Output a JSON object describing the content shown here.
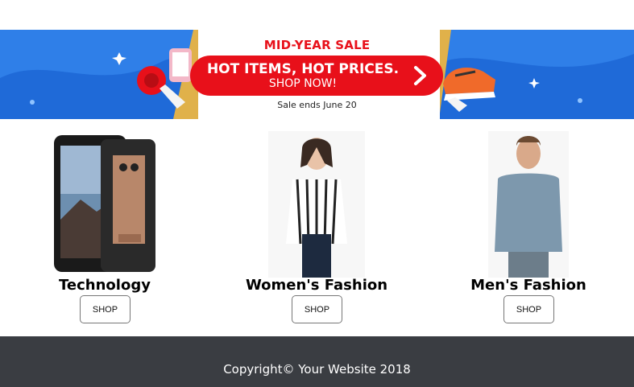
{
  "banner": {
    "title": "MID-YEAR SALE",
    "headline": "HOT ITEMS, HOT PRICES.",
    "cta": "SHOP NOW!",
    "sale_ends": "Sale ends June 20",
    "colors": {
      "accent": "#e8101a",
      "background": "#2f7fe8"
    }
  },
  "products": [
    {
      "title": "Technology",
      "button": "SHOP"
    },
    {
      "title": "Women's Fashion",
      "button": "SHOP"
    },
    {
      "title": "Men's Fashion",
      "button": "SHOP"
    }
  ],
  "footer": {
    "copyright": "Copyright© Your Website 2018",
    "color": "#3a3d42"
  }
}
